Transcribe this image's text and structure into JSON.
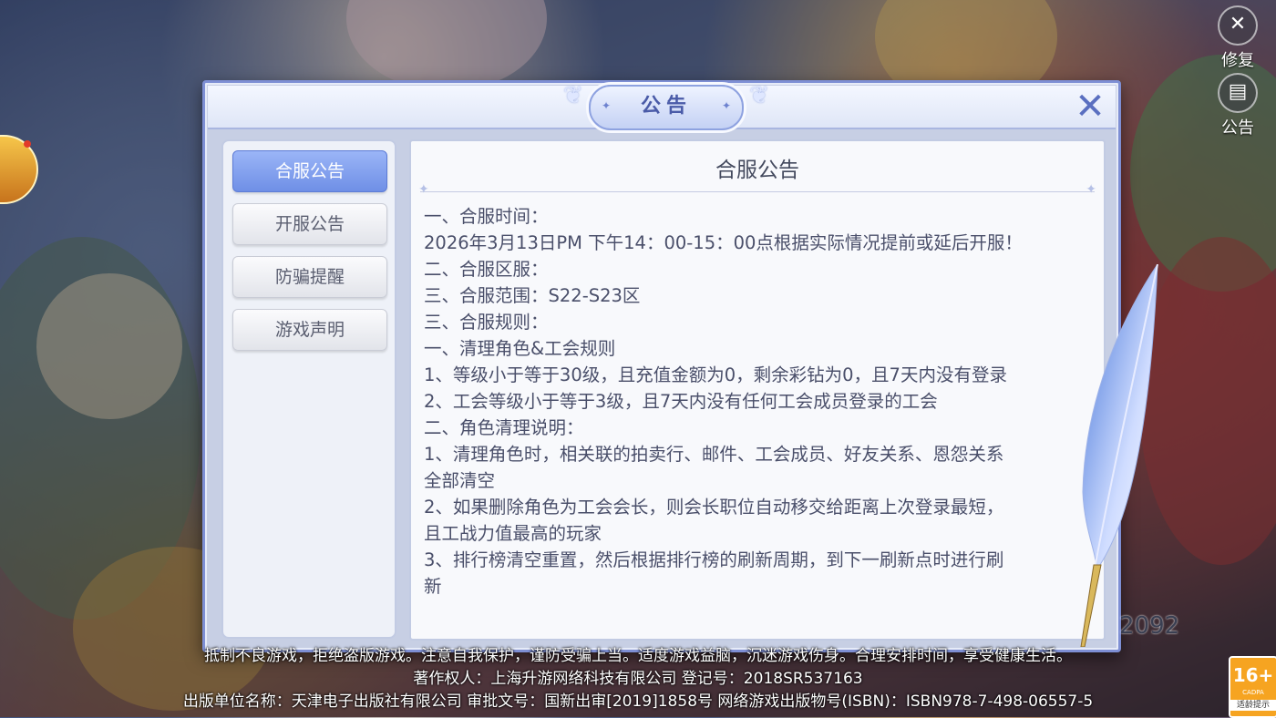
{
  "top_right": {
    "repair_label": "修复",
    "notice_label": "公告"
  },
  "dialog": {
    "title": "公告",
    "close_icon": "close-icon",
    "tabs": [
      {
        "label": "合服公告",
        "active": true
      },
      {
        "label": "开服公告",
        "active": false
      },
      {
        "label": "防骗提醒",
        "active": false
      },
      {
        "label": "游戏声明",
        "active": false
      }
    ],
    "content": {
      "title": "合服公告",
      "lines": [
        "一、合服时间：",
        "2026年3月13日PM 下午14：00-15：00点根据实际情况提前或延后开服！",
        "二、合服区服：",
        "三、合服范围：S22-S23区",
        "三、合服规则：",
        "一、清理角色&工会规则",
        "1、等级小于等于30级，且充值金额为0，剩余彩钻为0，且7天内没有登录",
        "2、工会等级小于等于3级，且7天内没有任何工会成员登录的工会",
        "二、角色清理说明：",
        "1、清理角色时，相关联的拍卖行、邮件、工会成员、好友关系、恩怨关系",
        "全部清空",
        "2、如果删除角色为工会会长，则会长职位自动移交给距离上次登录最短，",
        "且工战力值最高的玩家",
        "3、排行榜清空重置，然后根据排行榜的刷新周期，到下一刷新点时进行刷",
        "新"
      ]
    }
  },
  "background_number": "2092",
  "footer": {
    "line1": "抵制不良游戏，拒绝盗版游戏。注意自我保护，谨防受骗上当。适度游戏益脑，沉迷游戏伤身。合理安排时间，享受健康生活。",
    "line2": "著作权人：上海升游网络科技有限公司 登记号：2018SR537163",
    "line3": "出版单位名称：天津电子出版社有限公司 审批文号：国新出审[2019]1858号 网络游戏出版物号(ISBN)：ISBN978-7-498-06557-5"
  },
  "age_rating": {
    "value": "16+",
    "org": "CADPA",
    "label": "适龄提示"
  }
}
